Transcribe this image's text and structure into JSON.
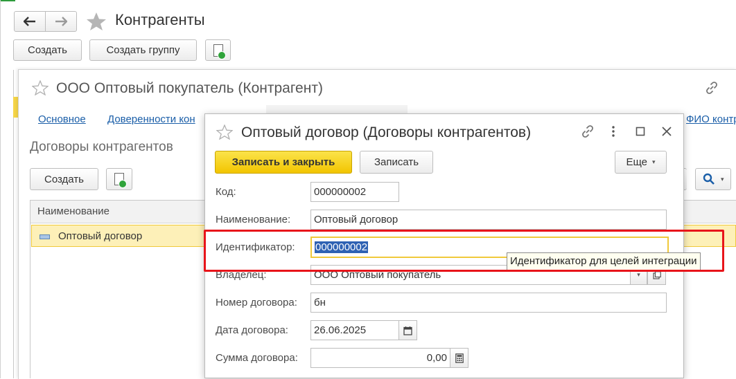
{
  "main": {
    "title": "Контрагенты",
    "create_label": "Создать",
    "create_group_label": "Создать группу"
  },
  "counterparty": {
    "title": "ООО Оптовый покупатель (Контрагент)",
    "tabs": [
      "Основное",
      "Доверенности кон",
      "ФИО контр"
    ],
    "section_title": "Договоры контрагентов",
    "create_label": "Создать",
    "column_name": "Наименование",
    "row_name": "Оптовый договор"
  },
  "dialog": {
    "title": "Оптовый договор (Договоры контрагентов)",
    "save_close_label": "Записать и закрыть",
    "save_label": "Записать",
    "more_label": "Еще",
    "fields": {
      "code_label": "Код:",
      "code_value": "000000002",
      "name_label": "Наименование:",
      "name_value": "Оптовый договор",
      "id_label": "Идентификатор:",
      "id_value": "000000002",
      "owner_label": "Владелец:",
      "owner_value": "ООО Оптовый покупатель",
      "number_label": "Номер договора:",
      "number_value": "бн",
      "date_label": "Дата договора:",
      "date_value": "26.06.2025",
      "sum_label": "Сумма договора:",
      "sum_value": "0,00"
    },
    "tooltip": "Идентификатор для целей интеграции"
  },
  "colors": {
    "accent_yellow": "#f2c500",
    "selection_row": "#fdf0b8",
    "highlight_red": "#e8141a",
    "link_blue": "#1a5ea8"
  }
}
